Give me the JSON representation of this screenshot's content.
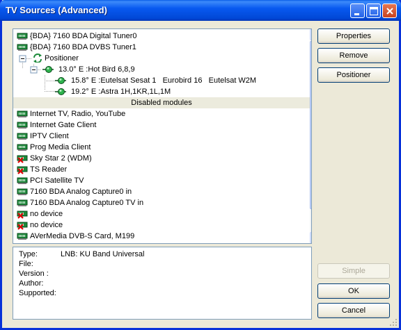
{
  "window": {
    "title": "TV Sources (Advanced)"
  },
  "tree": {
    "items": [
      {
        "label": "{BDA} 7160 BDA Digital Tuner0",
        "icon": "tuner-card-icon"
      },
      {
        "label": "{BDA} 7160 BDA DVBS Tuner1",
        "icon": "tuner-card-icon"
      },
      {
        "label": "Positioner",
        "icon": "positioner-icon"
      },
      {
        "label": "13.0° E :Hot Bird 6,8,9",
        "icon": "satellite-icon"
      },
      {
        "label": "15.8° E :Eutelsat Sesat 1   Eurobird 16   Eutelsat W2M",
        "icon": "satellite-icon"
      },
      {
        "label": "19.2° E :Astra 1H,1KR,1L,1M",
        "icon": "satellite-icon"
      },
      {
        "label": "Disabled modules",
        "icon": ""
      },
      {
        "label": "Internet TV, Radio, YouTube",
        "icon": "tuner-card-icon"
      },
      {
        "label": "Internet Gate Client",
        "icon": "tuner-card-icon"
      },
      {
        "label": "IPTV Client",
        "icon": "tuner-card-icon"
      },
      {
        "label": "Prog Media Client",
        "icon": "tuner-card-icon"
      },
      {
        "label": "Sky Star 2 (WDM)",
        "icon": "tuner-card-error-icon"
      },
      {
        "label": "TS Reader",
        "icon": "tuner-card-error-icon"
      },
      {
        "label": "PCI Satellite TV",
        "icon": "tuner-card-icon"
      },
      {
        "label": "7160 BDA Analog Capture0 in",
        "icon": "tuner-card-icon"
      },
      {
        "label": "7160 BDA Analog Capture0 TV in",
        "icon": "tuner-card-icon"
      },
      {
        "label": "no device",
        "icon": "tuner-card-error-icon"
      },
      {
        "label": "no device",
        "icon": "tuner-card-error-icon"
      },
      {
        "label": "AVerMedia DVB-S Card, M199",
        "icon": "tuner-card-icon"
      }
    ]
  },
  "info": {
    "type_key": "Type:",
    "type_val": "LNB: KU Band Universal",
    "file_key": "File:",
    "version_key": "Version :",
    "author_key": "Author:",
    "supported_key": "Supported:"
  },
  "buttons": {
    "properties": "Properties",
    "remove": "Remove",
    "positioner": "Positioner",
    "simple": "Simple",
    "ok": "OK",
    "cancel": "Cancel"
  },
  "colors": {
    "titlebar": "#0054e3",
    "window_bg": "#ece9d8",
    "tree_bg": "#ffffff",
    "border": "#7f9db9"
  }
}
